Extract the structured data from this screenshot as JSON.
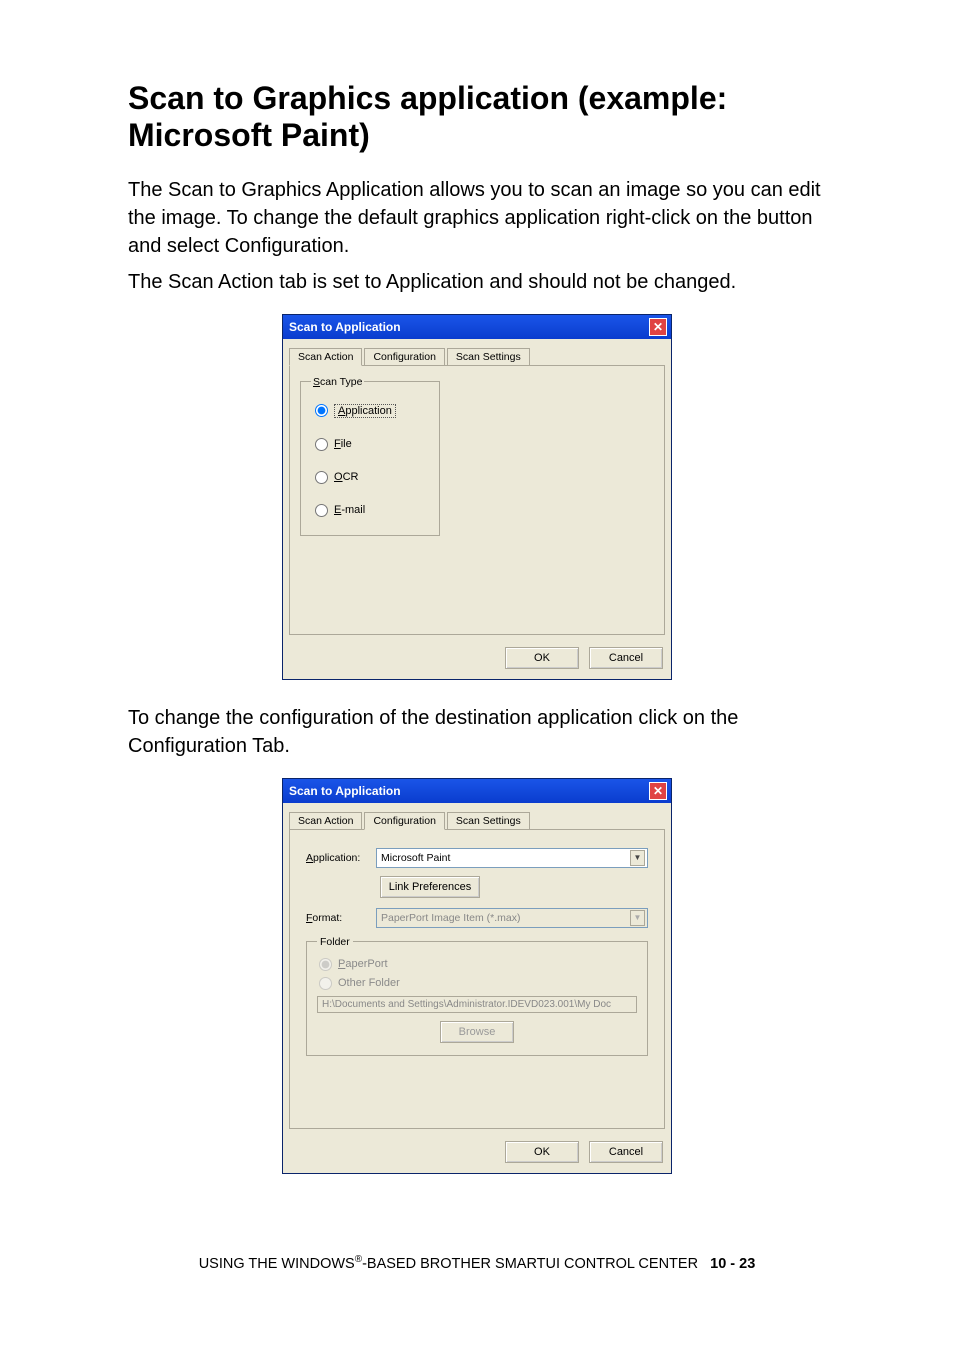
{
  "heading": "Scan to Graphics application (example: Microsoft Paint)",
  "para1": "The Scan to Graphics Application allows you to scan an image so you can edit the image. To change the default graphics application right-click on the button and select Configuration.",
  "para2": "The Scan Action tab is set to Application and should not be changed.",
  "para3": "To change the configuration of the destination application click on the Configuration Tab.",
  "dialog1": {
    "title": "Scan to Application",
    "tabs": [
      "Scan Action",
      "Configuration",
      "Scan Settings"
    ],
    "active_tab": 0,
    "group_legend": "Scan Type",
    "radios": {
      "application": "Application",
      "file": "File",
      "ocr": "OCR",
      "email": "E-mail"
    },
    "selected_radio": "application",
    "ok": "OK",
    "cancel": "Cancel"
  },
  "dialog2": {
    "title": "Scan to Application",
    "tabs": [
      "Scan Action",
      "Configuration",
      "Scan Settings"
    ],
    "active_tab": 1,
    "application_label": "Application:",
    "application_value": "Microsoft Paint",
    "link_prefs": "Link Preferences",
    "format_label": "Format:",
    "format_value": "PaperPort Image Item (*.max)",
    "folder_legend": "Folder",
    "radio_paperport": "PaperPort",
    "radio_other": "Other Folder",
    "path": "H:\\Documents and Settings\\Administrator.IDEVD023.001\\My Doc",
    "browse": "Browse",
    "ok": "OK",
    "cancel": "Cancel"
  },
  "footer": {
    "prefix": "USING THE WINDOWS",
    "reg": "®",
    "suffix": "-BASED BROTHER SMARTUI CONTROL CENTER",
    "page": "10 - 23"
  }
}
